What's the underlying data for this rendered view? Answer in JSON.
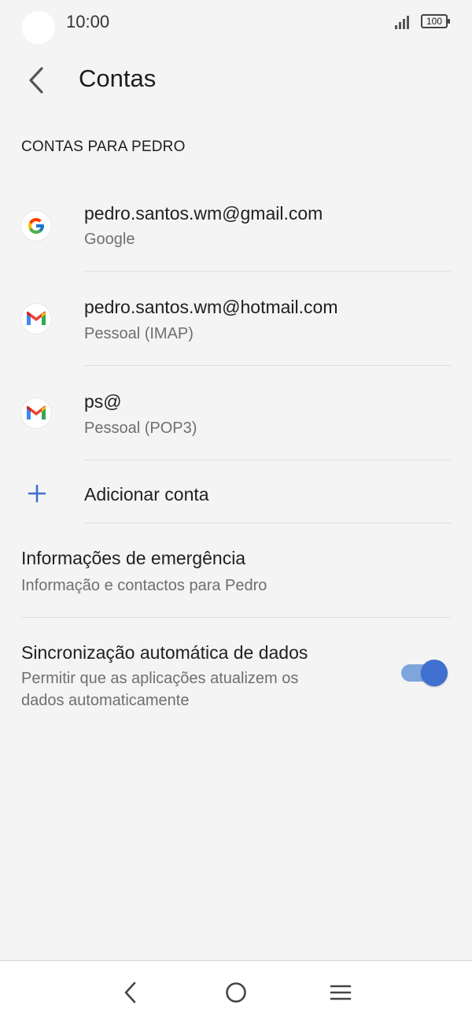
{
  "status_bar": {
    "time": "10:00",
    "battery": "100"
  },
  "header": {
    "title": "Contas"
  },
  "section": {
    "title": "CONTAS PARA PEDRO"
  },
  "accounts": [
    {
      "email": "pedro.santos.wm@gmail.com",
      "type": "Google",
      "icon": "google-icon"
    },
    {
      "email": "pedro.santos.wm@hotmail.com",
      "type": "Pessoal (IMAP)",
      "icon": "gmail-icon"
    },
    {
      "email": "ps@",
      "type": "Pessoal (POP3)",
      "icon": "gmail-icon"
    }
  ],
  "add_account": {
    "label": "Adicionar conta",
    "icon": "plus-icon"
  },
  "emergency": {
    "title": "Informações de emergência",
    "subtitle": "Informação e contactos para Pedro"
  },
  "auto_sync": {
    "title": "Sincronização automática de dados",
    "subtitle_line1": "Permitir que as aplicações atualizem os",
    "subtitle_line2": "dados automaticamente",
    "enabled": true
  },
  "nav": {
    "back": "back-icon",
    "home": "home-icon",
    "menu": "menu-icon"
  },
  "colors": {
    "accent": "#3f6fcf",
    "background": "#f4f4f4"
  }
}
